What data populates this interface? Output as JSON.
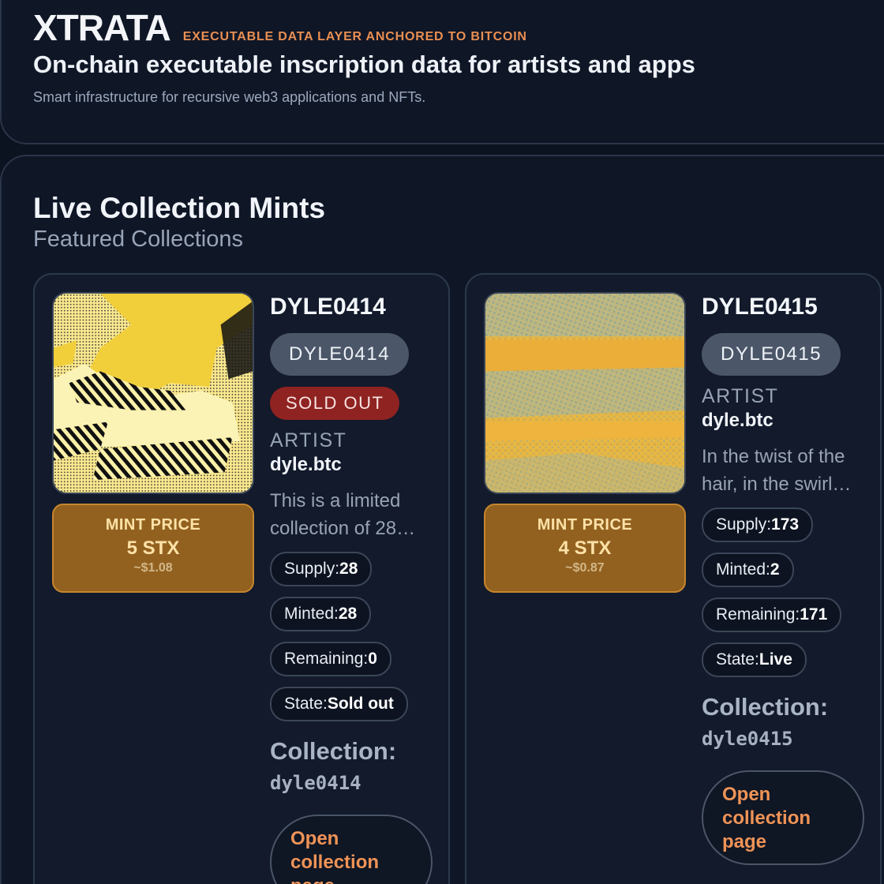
{
  "header": {
    "logo": "XTRATA",
    "tagline": "EXECUTABLE DATA LAYER ANCHORED TO BITCOIN",
    "headline": "On-chain executable inscription data for artists and apps",
    "subline": "Smart infrastructure for recursive web3 applications and NFTs."
  },
  "section": {
    "title": "Live Collection Mints",
    "subtitle": "Featured Collections"
  },
  "cards": [
    {
      "title": "DYLE0414",
      "symbol": "DYLE0414",
      "status": "SOLD OUT",
      "artist_label": "ARTIST",
      "artist": "dyle.btc",
      "description_lines": [
        "This is a limited",
        "collection of 28…"
      ],
      "price_label": "MINT PRICE",
      "price": "5 STX",
      "price_usd": "~$1.08",
      "stats": [
        {
          "label": "Supply:",
          "value": "28"
        },
        {
          "label": "Minted:",
          "value": "28"
        },
        {
          "label": "Remaining:",
          "value": "0"
        },
        {
          "label": "State:",
          "value": "Sold out"
        }
      ],
      "collection_label": "Collection:",
      "collection_id": "dyle0414",
      "open_button_lines": [
        "Open",
        "collection",
        "page"
      ],
      "art_colors": {
        "base": "#fbe98f",
        "accent": "#f1cf3b",
        "dark": "#111111"
      }
    },
    {
      "title": "DYLE0415",
      "symbol": "DYLE0415",
      "artist_label": "ARTIST",
      "artist": "dyle.btc",
      "description_lines": [
        "In the twist of the",
        "hair, in the swirl…"
      ],
      "price_label": "MINT PRICE",
      "price": "4 STX",
      "price_usd": "~$0.87",
      "stats": [
        {
          "label": "Supply:",
          "value": "173"
        },
        {
          "label": "Minted:",
          "value": "2"
        },
        {
          "label": "Remaining:",
          "value": "171"
        },
        {
          "label": "State:",
          "value": "Live"
        }
      ],
      "collection_label": "Collection:",
      "collection_id": "dyle0415",
      "open_button_lines": [
        "Open",
        "collection",
        "page"
      ],
      "art_colors": {
        "base": "#e8b843",
        "accent": "#a9b48e",
        "dark": "#c99a36"
      }
    }
  ]
}
